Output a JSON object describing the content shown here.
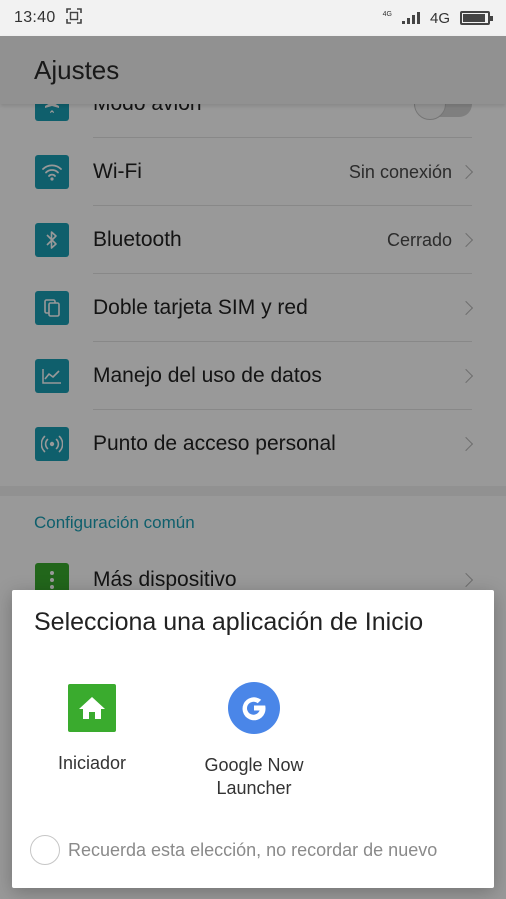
{
  "status_bar": {
    "time": "13:40",
    "network_small": "4G",
    "network": "4G",
    "battery_level": 0.9
  },
  "header": {
    "title": "Ajustes"
  },
  "settings": {
    "items": [
      {
        "label": "Modo avión",
        "value": "",
        "icon": "airplane-icon"
      },
      {
        "label": "Wi-Fi",
        "value": "Sin conexión",
        "icon": "wifi-icon"
      },
      {
        "label": "Bluetooth",
        "value": "Cerrado",
        "icon": "bluetooth-icon"
      },
      {
        "label": "Doble tarjeta SIM y red",
        "value": "",
        "icon": "sim-icon"
      },
      {
        "label": "Manejo del uso de datos",
        "value": "",
        "icon": "data-usage-icon"
      },
      {
        "label": "Punto de acceso personal",
        "value": "",
        "icon": "hotspot-icon"
      }
    ]
  },
  "common": {
    "section_title": "Configuración común",
    "items": [
      {
        "label": "Más dispositivo",
        "icon": "more-icon"
      }
    ]
  },
  "dialog": {
    "title": "Selecciona una aplicación de Inicio",
    "apps": [
      {
        "name": "Iniciador",
        "icon": "home-launcher-icon"
      },
      {
        "name": "Google Now\nLauncher",
        "icon": "google-icon"
      }
    ],
    "remember_label": "Recuerda esta elección, no recordar de nuevo"
  },
  "colors": {
    "accent": "#1a9fb5",
    "launcher_green": "#3aab2e",
    "google_blue": "#4a86e8"
  }
}
